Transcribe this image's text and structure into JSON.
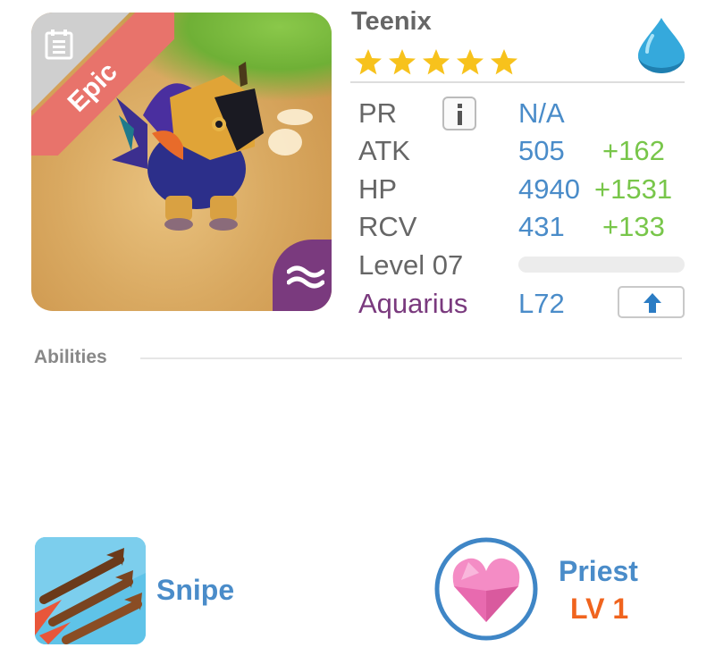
{
  "monster": {
    "name": "Teenix",
    "rarity": "Epic",
    "stars": 5,
    "element_icon": "water-drop-icon",
    "zodiac_icon": "aquarius-wave-icon"
  },
  "stats": [
    {
      "key": "pr",
      "label": "PR",
      "value": "N/A",
      "bonus": ""
    },
    {
      "key": "atk",
      "label": "ATK",
      "value": "505",
      "bonus": "+162"
    },
    {
      "key": "hp",
      "label": "HP",
      "value": "4940",
      "bonus": "+1531"
    },
    {
      "key": "rcv",
      "label": "RCV",
      "value": "431",
      "bonus": "+133"
    }
  ],
  "level": {
    "label": "Level 07",
    "progress": 0
  },
  "sign": {
    "label": "Aquarius",
    "value": "L72",
    "upgrade_icon": "arrow-up-icon"
  },
  "abilities": {
    "title": "Abilities",
    "skill": {
      "name": "Snipe",
      "icon": "snipe-arrows-icon"
    },
    "class": {
      "name": "Priest",
      "level": "LV 1",
      "icon": "heart-icon"
    }
  },
  "colors": {
    "accent_blue": "#4a8cc9",
    "bonus_green": "#78c64a",
    "epic_ribbon": "#e8736b",
    "aquarius_purple": "#7a3a7e",
    "star_gold": "#f7c21c",
    "level_orange": "#f0641e"
  }
}
